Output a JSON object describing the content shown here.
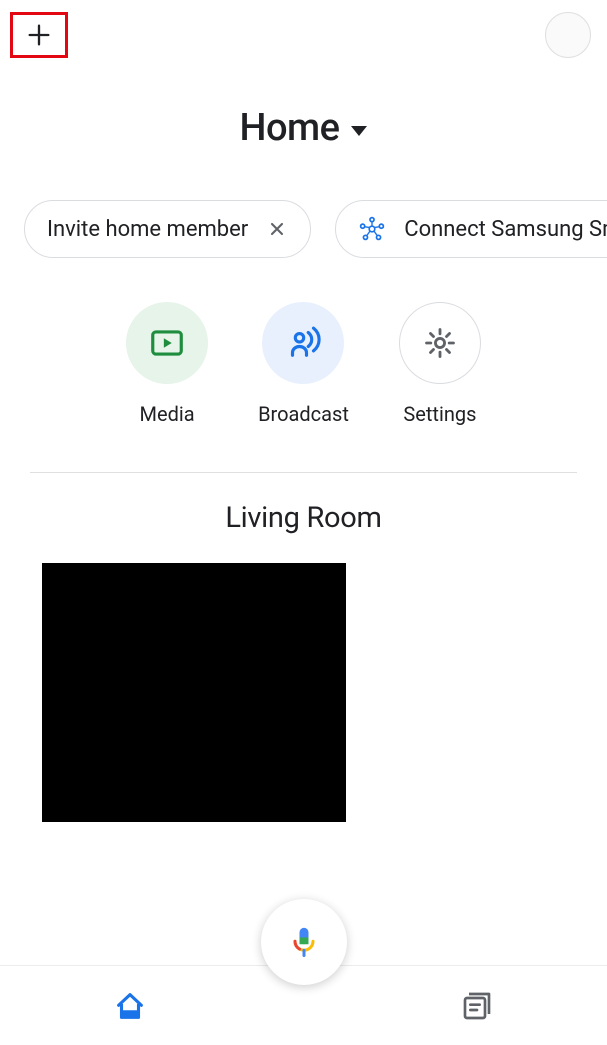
{
  "topbar": {
    "add_highlighted": true
  },
  "home_dropdown": {
    "label": "Home"
  },
  "chips": [
    {
      "label": "Invite home member",
      "dismissible": true,
      "icon": null
    },
    {
      "label": "Connect Samsung Sma",
      "dismissible": false,
      "icon": "smartthings"
    }
  ],
  "actions": [
    {
      "label": "Media",
      "icon": "play",
      "style": "green"
    },
    {
      "label": "Broadcast",
      "icon": "broadcast",
      "style": "blue"
    },
    {
      "label": "Settings",
      "icon": "gear",
      "style": "outline"
    }
  ],
  "room": {
    "title": "Living Room"
  },
  "bottom_nav": {
    "home": "home",
    "feed": "feed"
  }
}
